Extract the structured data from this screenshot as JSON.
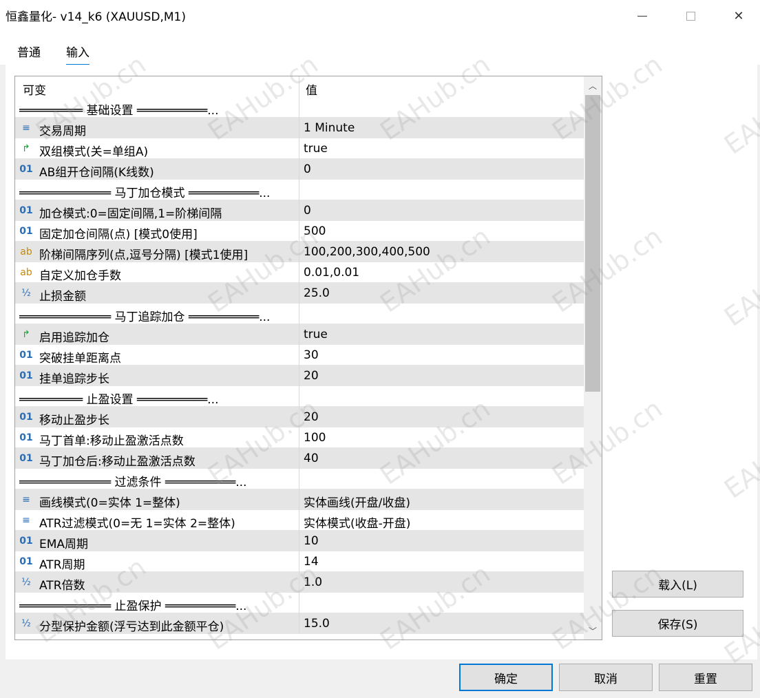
{
  "window": {
    "title": "恒鑫量化- v14_k6 (XAUUSD,M1)",
    "minimize_glyph": "—",
    "close_glyph": "✕"
  },
  "tabs": [
    {
      "label": "普通",
      "active": false
    },
    {
      "label": "输入",
      "active": true
    }
  ],
  "grid": {
    "col_name": "可变",
    "col_value": "值",
    "rows": [
      {
        "type": "sep",
        "name": "═════════ 基础设置 ══════════...",
        "value": ""
      },
      {
        "type": "enum",
        "icon": "≡",
        "name": "交易周期",
        "value": "1 Minute"
      },
      {
        "type": "bool",
        "icon": "↱",
        "name": "双组模式(关=单组A)",
        "value": "true"
      },
      {
        "type": "int",
        "icon": "01",
        "name": "AB组开仓间隔(K线数)",
        "value": "0"
      },
      {
        "type": "sep",
        "name": "═════════════ 马丁加仓模式 ══════════...",
        "value": ""
      },
      {
        "type": "int",
        "icon": "01",
        "name": "加仓模式:0=固定间隔,1=阶梯间隔",
        "value": "0"
      },
      {
        "type": "int",
        "icon": "01",
        "name": "固定加仓间隔(点) [模式0使用]",
        "value": "500"
      },
      {
        "type": "str",
        "icon": "ab",
        "name": "阶梯间隔序列(点,逗号分隔) [模式1使用]",
        "value": "100,200,300,400,500"
      },
      {
        "type": "str",
        "icon": "ab",
        "name": "自定义加仓手数",
        "value": "0.01,0.01"
      },
      {
        "type": "dbl",
        "icon": "½",
        "name": "止损金额",
        "value": "25.0"
      },
      {
        "type": "sep",
        "name": "═════════════ 马丁追踪加仓 ══════════...",
        "value": ""
      },
      {
        "type": "bool",
        "icon": "↱",
        "name": "启用追踪加仓",
        "value": "true"
      },
      {
        "type": "int",
        "icon": "01",
        "name": "突破挂单距离点",
        "value": "30"
      },
      {
        "type": "int",
        "icon": "01",
        "name": "挂单追踪步长",
        "value": "20"
      },
      {
        "type": "sep",
        "name": "═════════ 止盈设置 ══════════...",
        "value": ""
      },
      {
        "type": "int",
        "icon": "01",
        "name": "移动止盈步长",
        "value": "20"
      },
      {
        "type": "int",
        "icon": "01",
        "name": "马丁首单:移动止盈激活点数",
        "value": "100"
      },
      {
        "type": "int",
        "icon": "01",
        "name": "马丁加仓后:移动止盈激活点数",
        "value": "40"
      },
      {
        "type": "sep",
        "name": "═════════════ 过滤条件 ══════════...",
        "value": ""
      },
      {
        "type": "enum",
        "icon": "≡",
        "name": "画线模式(0=实体 1=整体)",
        "value": "实体画线(开盘/收盘)"
      },
      {
        "type": "enum",
        "icon": "≡",
        "name": "ATR过滤模式(0=无 1=实体 2=整体)",
        "value": "实体模式(收盘-开盘)"
      },
      {
        "type": "int",
        "icon": "01",
        "name": "EMA周期",
        "value": "10"
      },
      {
        "type": "int",
        "icon": "01",
        "name": "ATR周期",
        "value": "14"
      },
      {
        "type": "dbl",
        "icon": "½",
        "name": "ATR倍数",
        "value": "1.0"
      },
      {
        "type": "sep",
        "name": "═════════════ 止盈保护 ══════════...",
        "value": ""
      },
      {
        "type": "dbl",
        "icon": "½",
        "name": "分型保护金额(浮亏达到此金额平仓)",
        "value": "15.0"
      }
    ]
  },
  "buttons": {
    "load": "载入(L)",
    "save": "保存(S)",
    "ok": "确定",
    "cancel": "取消",
    "reset": "重置"
  },
  "watermark": "EAHub.cn",
  "colors": {
    "accent": "#0078d7",
    "row_shade": "#e5e5e5",
    "icon_blue": "#2a6db5",
    "icon_green": "#1ea03c",
    "icon_gold": "#c68a00"
  }
}
